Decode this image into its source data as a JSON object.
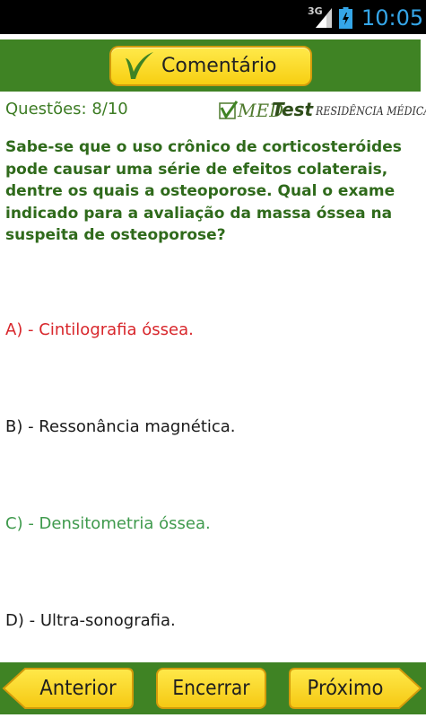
{
  "status_bar": {
    "network": "3G",
    "time": "10:05",
    "icons": [
      "signal-icon",
      "battery-charging-icon"
    ]
  },
  "header": {
    "comment_button_label": "Comentário",
    "comment_icon": "check-mark-icon"
  },
  "quiz": {
    "question_counter": "Questões: 8/10",
    "logo": {
      "med": "Med",
      "test": "Test",
      "subtitle": "Residência Médica"
    },
    "question": "Sabe-se que o uso crônico de corticosteróides pode causar uma série de efeitos colaterais, dentre os quais a osteoporose. Qual o exame indicado para a avaliação da massa óssea na suspeita de osteoporose?",
    "options": [
      {
        "label": "A) - Cintilografia óssea.",
        "state": "incorrect",
        "color": "#d8262b"
      },
      {
        "label": "B) - Ressonância magnética.",
        "state": "neutral",
        "color": "#1a1a1a"
      },
      {
        "label": "C) - Densitometria óssea.",
        "state": "correct",
        "color": "#3f9a4d"
      },
      {
        "label": "D) - Ultra-sonografia.",
        "state": "neutral",
        "color": "#1a1a1a"
      }
    ]
  },
  "footer": {
    "prev_label": "Anterior",
    "end_label": "Encerrar",
    "next_label": "Próximo"
  },
  "colors": {
    "band_green": "#3f8324",
    "button_yellow": "#f7cf12",
    "question_green": "#2f6a1b",
    "clock_blue": "#35a6e8"
  }
}
